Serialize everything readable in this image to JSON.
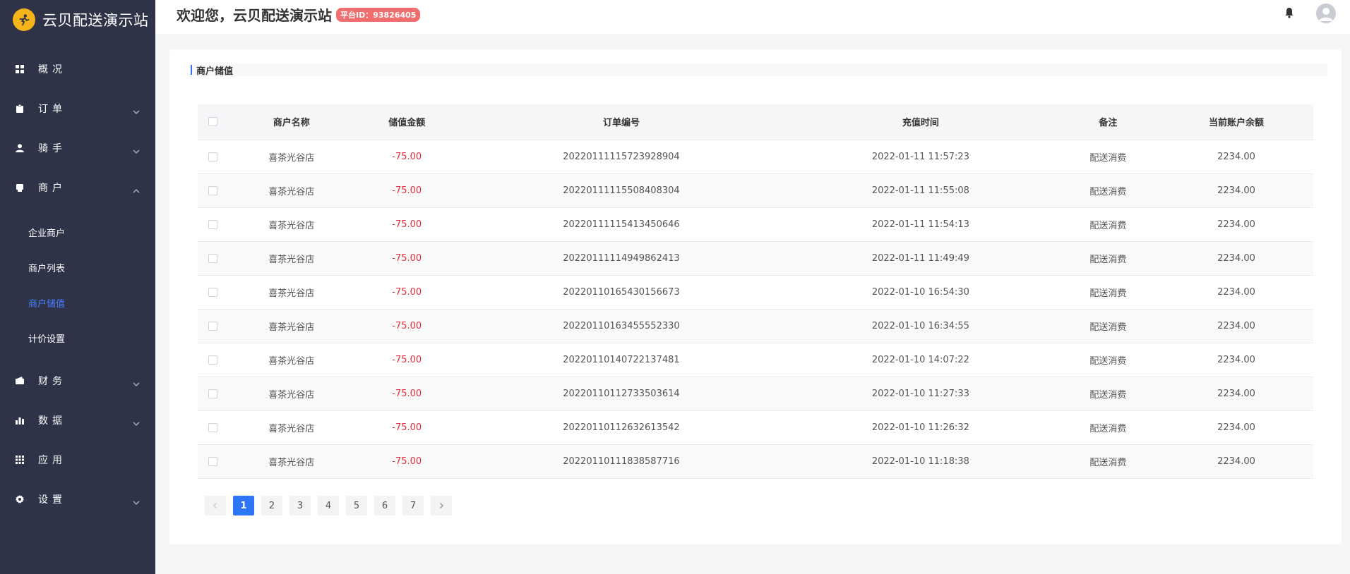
{
  "brand": {
    "name": "云贝配送演示站"
  },
  "header": {
    "welcome": "欢迎您，云贝配送演示站",
    "platform_badge": "平台ID：93826405"
  },
  "sidebar": {
    "items": [
      {
        "label": "概况",
        "icon": "dashboard-icon"
      },
      {
        "label": "订单",
        "icon": "clipboard-icon"
      },
      {
        "label": "骑手",
        "icon": "user-icon"
      },
      {
        "label": "商户",
        "icon": "store-icon"
      },
      {
        "label": "财务",
        "icon": "wallet-icon"
      },
      {
        "label": "数据",
        "icon": "bar-chart-icon"
      },
      {
        "label": "应用",
        "icon": "grid-icon"
      },
      {
        "label": "设置",
        "icon": "gear-icon"
      }
    ],
    "merchant_sub": [
      "企业商户",
      "商户列表",
      "商户储值",
      "计价设置"
    ]
  },
  "panel": {
    "title": "商户储值"
  },
  "table": {
    "headers": [
      "商户名称",
      "储值金额",
      "订单编号",
      "充值时间",
      "备注",
      "当前账户余额"
    ],
    "rows": [
      [
        "喜茶光谷店",
        "-75.00",
        "20220111115723928904",
        "2022-01-11 11:57:23",
        "配送消费",
        "2234.00"
      ],
      [
        "喜茶光谷店",
        "-75.00",
        "20220111115508408304",
        "2022-01-11 11:55:08",
        "配送消费",
        "2234.00"
      ],
      [
        "喜茶光谷店",
        "-75.00",
        "20220111115413450646",
        "2022-01-11 11:54:13",
        "配送消费",
        "2234.00"
      ],
      [
        "喜茶光谷店",
        "-75.00",
        "20220111114949862413",
        "2022-01-11 11:49:49",
        "配送消费",
        "2234.00"
      ],
      [
        "喜茶光谷店",
        "-75.00",
        "20220110165430156673",
        "2022-01-10 16:54:30",
        "配送消费",
        "2234.00"
      ],
      [
        "喜茶光谷店",
        "-75.00",
        "20220110163455552330",
        "2022-01-10 16:34:55",
        "配送消费",
        "2234.00"
      ],
      [
        "喜茶光谷店",
        "-75.00",
        "20220110140722137481",
        "2022-01-10 14:07:22",
        "配送消费",
        "2234.00"
      ],
      [
        "喜茶光谷店",
        "-75.00",
        "20220110112733503614",
        "2022-01-10 11:27:33",
        "配送消费",
        "2234.00"
      ],
      [
        "喜茶光谷店",
        "-75.00",
        "20220110112632613542",
        "2022-01-10 11:26:32",
        "配送消费",
        "2234.00"
      ],
      [
        "喜茶光谷店",
        "-75.00",
        "20220110111838587716",
        "2022-01-10 11:18:38",
        "配送消费",
        "2234.00"
      ]
    ]
  },
  "pagination": {
    "pages": [
      "1",
      "2",
      "3",
      "4",
      "5",
      "6",
      "7"
    ],
    "current": "1"
  },
  "colors": {
    "sidebar_bg": "#2e3347",
    "accent": "#2d76f5",
    "negative": "#e0303b",
    "badge": "#f26d6d"
  }
}
